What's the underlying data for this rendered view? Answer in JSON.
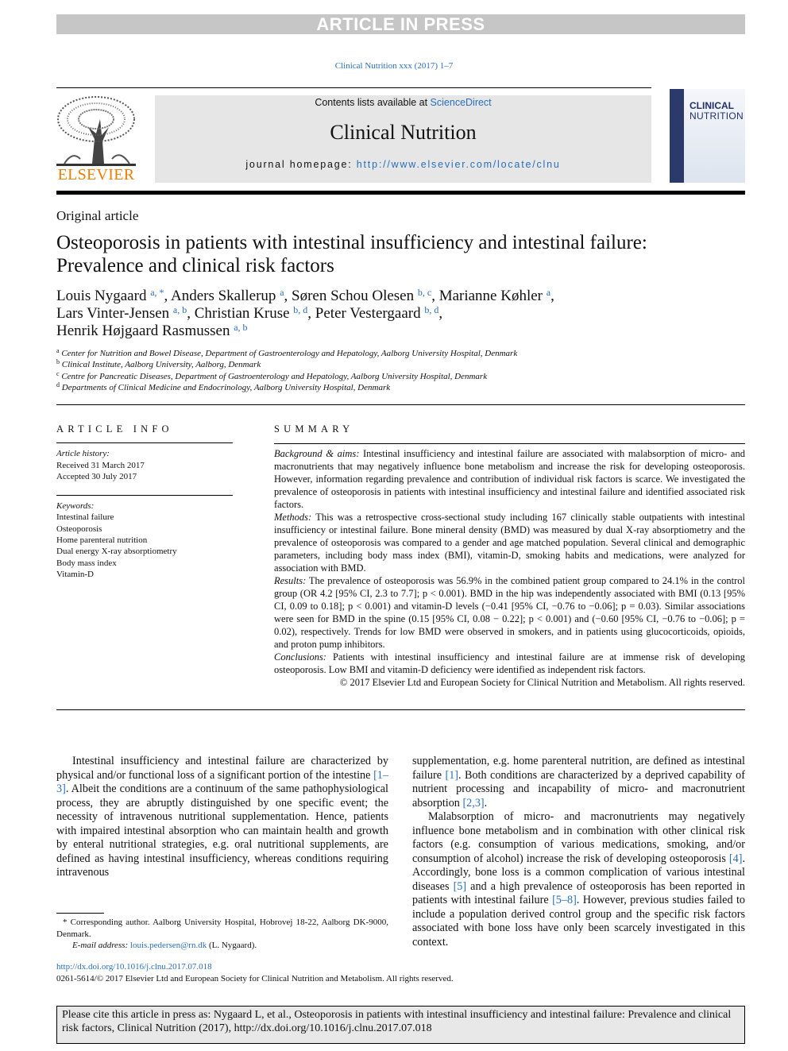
{
  "banner": "ARTICLE IN PRESS",
  "journal_ref": "Clinical Nutrition xxx (2017) 1–7",
  "header": {
    "publisher_logo": "ELSEVIER",
    "contents_prefix": "Contents lists available at ",
    "contents_link": "ScienceDirect",
    "journal_name": "Clinical Nutrition",
    "homepage_prefix": "journal homepage: ",
    "homepage_link": "http://www.elsevier.com/locate/clnu",
    "cover_title_1": "CLINICAL",
    "cover_title_2": "NUTRITION"
  },
  "article_type": "Original article",
  "title": "Osteoporosis in patients with intestinal insufficiency and intestinal failure: Prevalence and clinical risk factors",
  "authors": [
    [
      {
        "t": "Louis Nygaard "
      },
      {
        "s": "a, *"
      },
      {
        "t": ", Anders Skallerup "
      },
      {
        "s": "a"
      },
      {
        "t": ", Søren Schou Olesen "
      },
      {
        "s": "b, c"
      },
      {
        "t": ", Marianne Køhler "
      },
      {
        "s": "a"
      },
      {
        "t": ","
      }
    ],
    [
      {
        "t": "Lars Vinter-Jensen "
      },
      {
        "s": "a, b"
      },
      {
        "t": ", Christian Kruse "
      },
      {
        "s": "b, d"
      },
      {
        "t": ", Peter Vestergaard "
      },
      {
        "s": "b, d"
      },
      {
        "t": ","
      }
    ],
    [
      {
        "t": "Henrik Højgaard Rasmussen "
      },
      {
        "s": "a, b"
      }
    ]
  ],
  "affiliations": [
    {
      "key": "a",
      "text": "Center for Nutrition and Bowel Disease, Department of Gastroenterology and Hepatology, Aalborg University Hospital, Denmark"
    },
    {
      "key": "b",
      "text": "Clinical Institute, Aalborg University, Aalborg, Denmark"
    },
    {
      "key": "c",
      "text": "Centre for Pancreatic Diseases, Department of Gastroenterology and Hepatology, Aalborg University Hospital, Denmark"
    },
    {
      "key": "d",
      "text": "Departments of Clinical Medicine and Endocrinology, Aalborg University Hospital, Denmark"
    }
  ],
  "article_info": {
    "heading": "ARTICLE INFO",
    "history_label": "Article history:",
    "received": "Received 31 March 2017",
    "accepted": "Accepted 30 July 2017",
    "keywords_label": "Keywords:",
    "keywords": [
      "Intestinal failure",
      "Osteoporosis",
      "Home parenteral nutrition",
      "Dual energy X-ray absorptiometry",
      "Body mass index",
      "Vitamin-D"
    ]
  },
  "summary": {
    "heading": "SUMMARY",
    "sections": [
      {
        "label": "Background & aims:",
        "text": " Intestinal insufficiency and intestinal failure are associated with malabsorption of micro- and macronutrients that may negatively influence bone metabolism and increase the risk for developing osteoporosis. However, information regarding prevalence and contribution of individual risk factors is scarce. We investigated the prevalence of osteoporosis in patients with intestinal insufficiency and intestinal failure and identified associated risk factors."
      },
      {
        "label": "Methods:",
        "text": " This was a retrospective cross-sectional study including 167 clinically stable outpatients with intestinal insufficiency or intestinal failure. Bone mineral density (BMD) was measured by dual X-ray absorptiometry and the prevalence of osteoporosis was compared to a gender and age matched population. Several clinical and demographic parameters, including body mass index (BMI), vitamin-D, smoking habits and medications, were analyzed for association with BMD."
      },
      {
        "label": "Results:",
        "text": " The prevalence of osteoporosis was 56.9% in the combined patient group compared to 24.1% in the control group (OR 4.2 [95% CI, 2.3 to 7.7]; p < 0.001). BMD in the hip was independently associated with BMI (0.13 [95% CI, 0.09 to 0.18]; p < 0.001) and vitamin-D levels (−0.41 [95% CI, −0.76 to −0.06]; p = 0.03). Similar associations were seen for BMD in the spine (0.15 [95% CI, 0.08 − 0.22]; p < 0.001) and (−0.60 [95% CI, −0.76 to −0.06]; p = 0.02), respectively. Trends for low BMD were observed in smokers, and in patients using glucocorticoids, opioids, and proton pump inhibitors."
      },
      {
        "label": "Conclusions:",
        "text": " Patients with intestinal insufficiency and intestinal failure are at immense risk of developing osteoporosis. Low BMI and vitamin-D deficiency were identified as independent risk factors."
      }
    ],
    "copyright": "© 2017 Elsevier Ltd and European Society for Clinical Nutrition and Metabolism. All rights reserved."
  },
  "body_left": [
    [
      {
        "t": "Intestinal insufficiency and intestinal failure are characterized by physical and/or functional loss of a significant portion of the intestine "
      },
      {
        "r": "[1–3]"
      },
      {
        "t": ". Albeit the conditions are a continuum of the same pathophysiological process, they are abruptly distinguished by one specific event; the necessity of intravenous nutritional supplementation. Hence, patients with impaired intestinal absorption who can maintain health and growth by enteral nutritional strategies, e.g. oral nutritional supplements, are defined as having intestinal insufficiency, whereas conditions requiring intravenous"
      }
    ]
  ],
  "body_right": [
    [
      {
        "t": "supplementation, e.g. home parenteral nutrition, are defined as intestinal failure "
      },
      {
        "r": "[1]"
      },
      {
        "t": ". Both conditions are characterized by a deprived capability of nutrient processing and incapability of micro- and macronutrient absorption "
      },
      {
        "r": "[2,3]"
      },
      {
        "t": "."
      }
    ],
    [
      {
        "t": "Malabsorption of micro- and macronutrients may negatively influence bone metabolism and in combination with other clinical risk factors (e.g. consumption of various medications, smoking, and/or consumption of alcohol) increase the risk of developing osteoporosis "
      },
      {
        "r": "[4]"
      },
      {
        "t": ". Accordingly, bone loss is a common complication of various intestinal diseases "
      },
      {
        "r": "[5]"
      },
      {
        "t": " and a high prevalence of osteoporosis has been reported in patients with intestinal failure "
      },
      {
        "r": "[5–8]"
      },
      {
        "t": ". However, previous studies failed to include a population derived control group and the specific risk factors associated with bone loss have only been scarcely investigated in this context."
      }
    ]
  ],
  "footnote": {
    "corresponding": "* Corresponding author. Aalborg University Hospital, Hobrovej 18-22, Aalborg DK-9000, Denmark.",
    "email_label": "E-mail address:",
    "email": "louis.pedersen@rn.dk",
    "email_suffix": " (L. Nygaard)."
  },
  "doi": "http://dx.doi.org/10.1016/j.clnu.2017.07.018",
  "issn_copyright": "0261-5614/© 2017 Elsevier Ltd and European Society for Clinical Nutrition and Metabolism. All rights reserved.",
  "citation_box": "Please cite this article in press as: Nygaard L, et al., Osteoporosis in patients with intestinal insufficiency and intestinal failure: Prevalence and clinical risk factors, Clinical Nutrition (2017), http://dx.doi.org/10.1016/j.clnu.2017.07.018",
  "colors": {
    "link": "#2a6ebb",
    "elsevier_orange": "#f07c00",
    "banner_gray": "#c6c6c6",
    "header_gray": "#e6e6e6"
  }
}
